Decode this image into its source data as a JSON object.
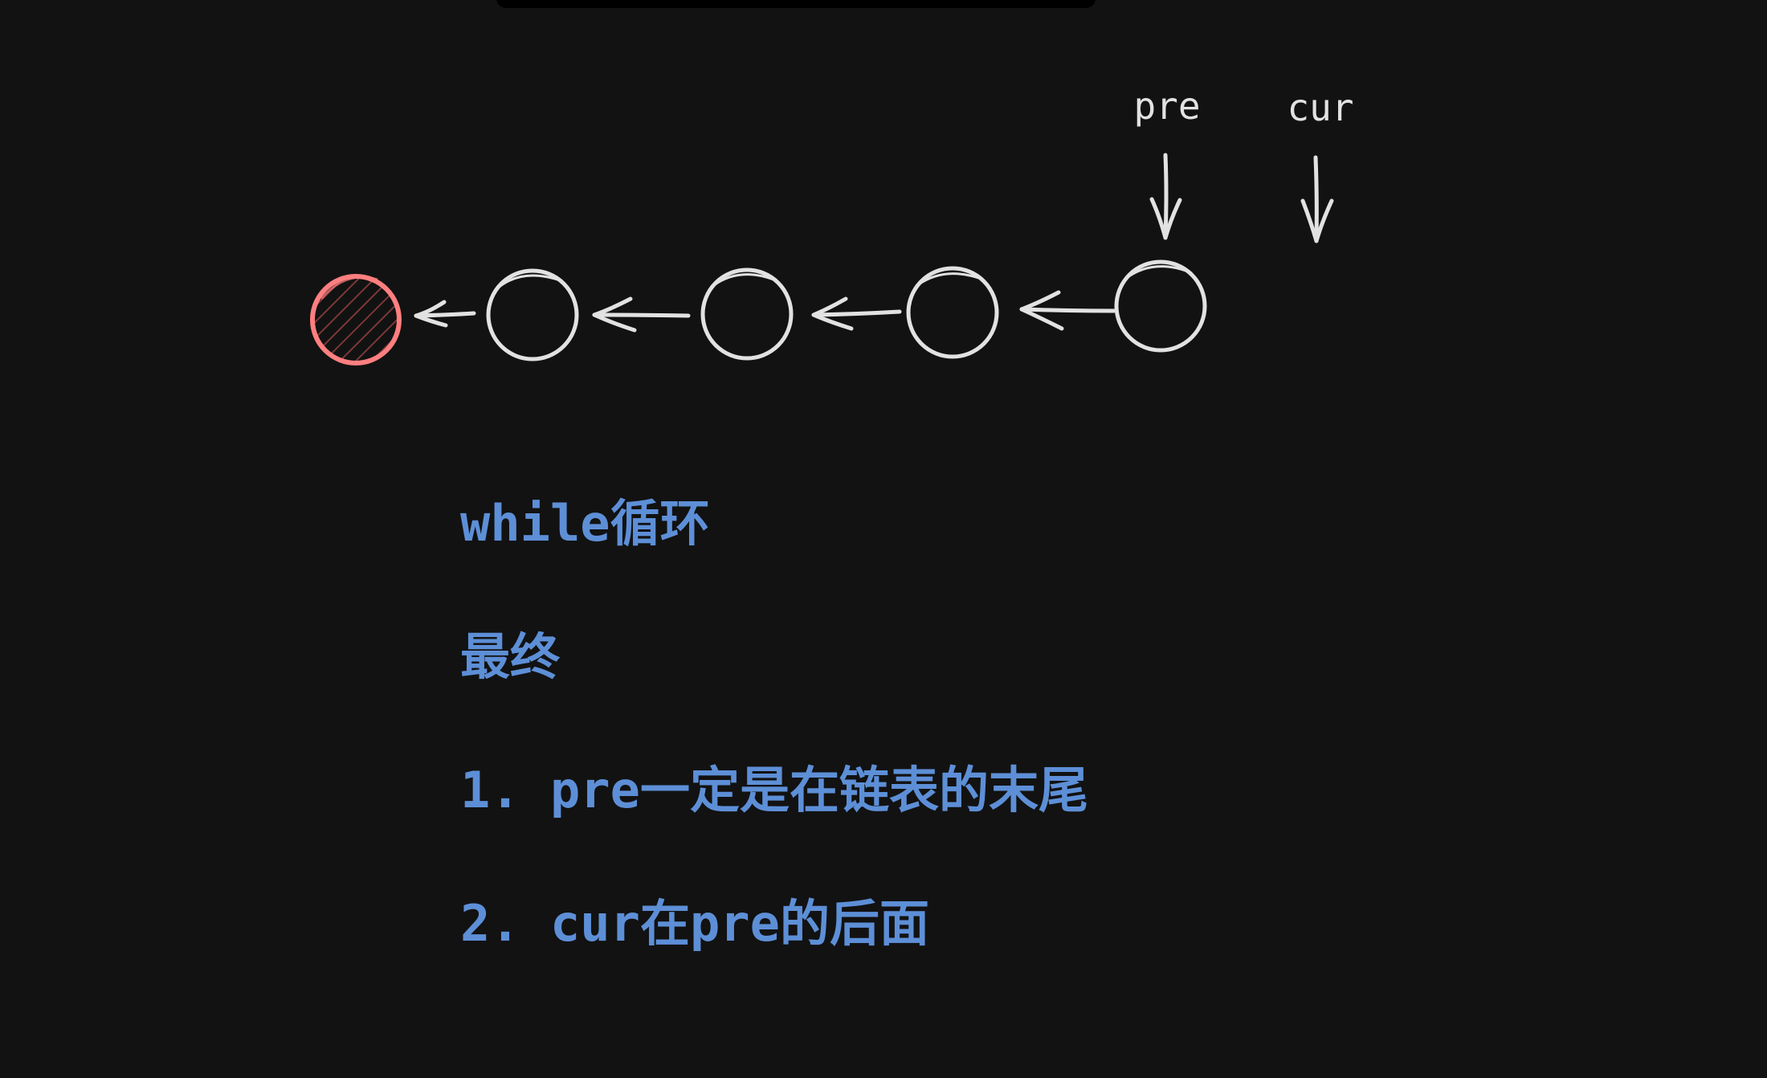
{
  "colors": {
    "background": "#121212",
    "stroke": "#e2e2e2",
    "highlight": "#ff7f7f",
    "hatch": "#7a3838",
    "note_text": "#5d8fd7"
  },
  "diagram": {
    "pointers": [
      {
        "name": "pre",
        "label": "pre"
      },
      {
        "name": "cur",
        "label": "cur"
      }
    ],
    "nodes": [
      {
        "name": "highlighted-node",
        "highlighted": true
      },
      {
        "name": "node-2",
        "highlighted": false
      },
      {
        "name": "node-3",
        "highlighted": false
      },
      {
        "name": "node-4",
        "highlighted": false
      },
      {
        "name": "node-5",
        "highlighted": false
      }
    ],
    "arrow_direction": "left"
  },
  "notes": [
    "while循环",
    "最终",
    "1. pre一定是在链表的末尾",
    "2. cur在pre的后面"
  ]
}
